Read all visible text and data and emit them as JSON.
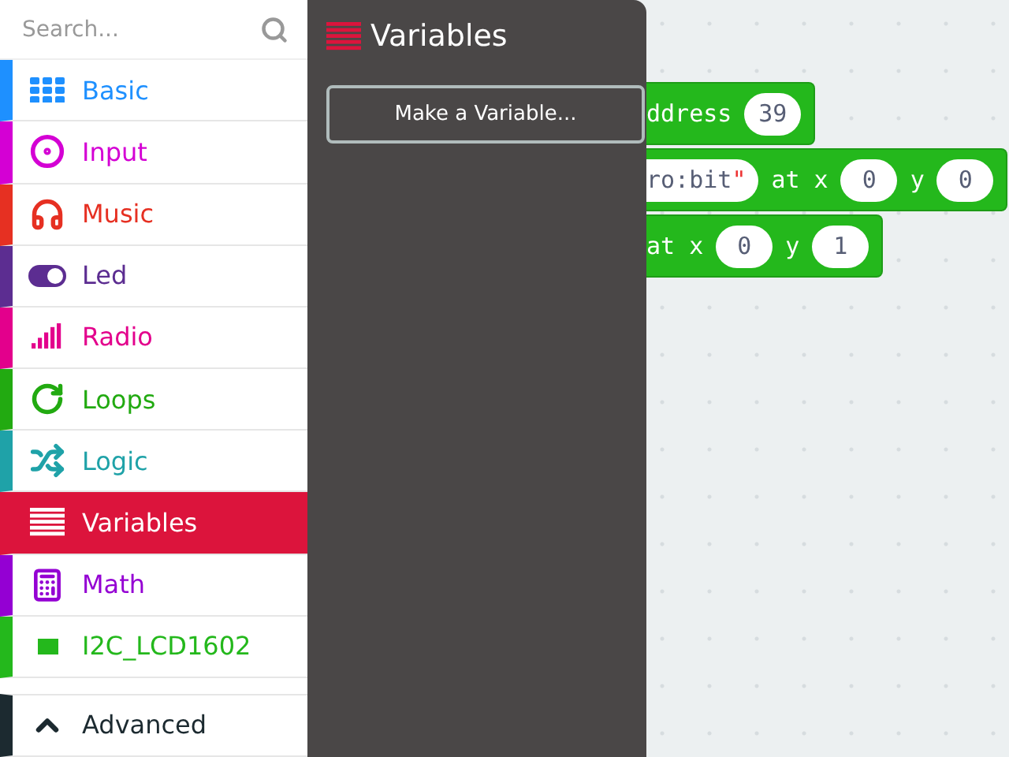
{
  "sidebar": {
    "search": {
      "placeholder": "Search..."
    },
    "items": [
      {
        "label": "Basic",
        "kind": "grid",
        "color": "#1e90ff",
        "selected": false
      },
      {
        "label": "Input",
        "kind": "target",
        "color": "#d400d4",
        "selected": false
      },
      {
        "label": "Music",
        "kind": "headphones",
        "color": "#e63022",
        "selected": false
      },
      {
        "label": "Led",
        "kind": "toggle",
        "color": "#5c2d91",
        "selected": false
      },
      {
        "label": "Radio",
        "kind": "signal",
        "color": "#e3008c",
        "selected": false
      },
      {
        "label": "Loops",
        "kind": "loop",
        "color": "#22aa11",
        "selected": false
      },
      {
        "label": "Logic",
        "kind": "shuffle",
        "color": "#1fa2a8",
        "selected": false
      },
      {
        "label": "Variables",
        "kind": "list",
        "color": "#dc143c",
        "selected": true
      },
      {
        "label": "Math",
        "kind": "calculator",
        "color": "#9400d3",
        "selected": false
      },
      {
        "label": "I2C_LCD1602",
        "kind": "square",
        "color": "#24b81c",
        "selected": false
      }
    ],
    "advanced": {
      "label": "Advanced",
      "expanded": false
    }
  },
  "flyout": {
    "title": "Variables",
    "button": "Make a Variable..."
  },
  "blocks": [
    [
      {
        "kind": "word",
        "text": "ddress"
      },
      {
        "kind": "number",
        "text": "39"
      }
    ],
    [
      {
        "kind": "string",
        "text": "ro:bit",
        "quote": "\""
      },
      {
        "kind": "word",
        "text": "at x"
      },
      {
        "kind": "number",
        "text": "0"
      },
      {
        "kind": "word",
        "text": "y"
      },
      {
        "kind": "number",
        "text": "0"
      }
    ],
    [
      {
        "kind": "word",
        "text": "at x"
      },
      {
        "kind": "number",
        "text": "0"
      },
      {
        "kind": "word",
        "text": "y"
      },
      {
        "kind": "number",
        "text": "1"
      }
    ]
  ]
}
